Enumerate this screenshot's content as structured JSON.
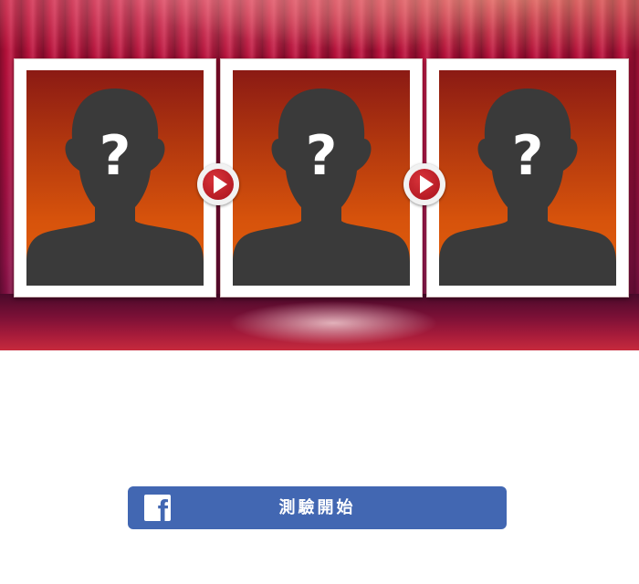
{
  "stage": {
    "slots": [
      {
        "placeholder": "?"
      },
      {
        "placeholder": "?"
      },
      {
        "placeholder": "?"
      }
    ],
    "arrow_icon": "play-arrow-icon",
    "silhouette_icon": "person-silhouette-icon"
  },
  "facebook_button": {
    "logo": "f",
    "label": "測驗開始",
    "color": "#4267b2"
  }
}
